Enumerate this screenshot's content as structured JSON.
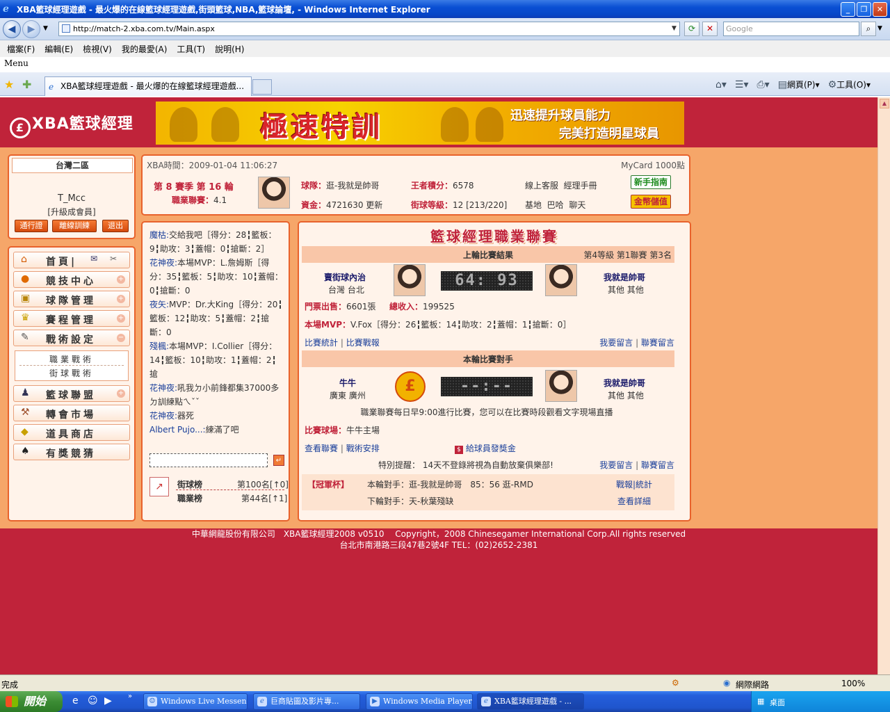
{
  "window": {
    "title": "XBA籃球經理遊戲 - 最火爆的在線籃球經理遊戲,街頭籃球,NBA,籃球論壇, - Windows Internet Explorer"
  },
  "address": {
    "url": "http://match-2.xba.com.tv/Main.aspx",
    "search_placeholder": "Google"
  },
  "menu": {
    "items": [
      "檔案(F)",
      "編輯(E)",
      "檢視(V)",
      "我的最愛(A)",
      "工具(T)",
      "說明(H)"
    ],
    "label": "Menu"
  },
  "tab": {
    "title": "XBA籃球經理遊戲 - 最火爆的在線籃球經理遊戲..."
  },
  "commands": {
    "page": "網頁(P)",
    "tools": "工具(O)"
  },
  "site": {
    "logo": "XBA籃球經理",
    "banner": {
      "title": "極速特訓",
      "sub1": "迅速提升球員能力",
      "sub2": "完美打造明星球員"
    }
  },
  "user": {
    "region": "台灣二區",
    "name": "T_Mcc",
    "upgrade": "[升級成會員]",
    "buttons": [
      "通行證",
      "離線訓練",
      "退出"
    ]
  },
  "nav": {
    "items": [
      {
        "label": "首頁|",
        "icon": "home-icon"
      },
      {
        "label": "競技中心",
        "icon": "basketball-icon"
      },
      {
        "label": "球隊管理",
        "icon": "team-icon"
      },
      {
        "label": "賽程管理",
        "icon": "trophy-icon"
      },
      {
        "label": "戰術設定",
        "icon": "tactics-icon"
      },
      {
        "label": "籃球聯盟",
        "icon": "league-icon"
      },
      {
        "label": "轉會市場",
        "icon": "hammer-icon"
      },
      {
        "label": "道具商店",
        "icon": "shop-icon"
      },
      {
        "label": "有獎競猜",
        "icon": "spade-icon"
      }
    ],
    "sub_items": [
      "職業戰術",
      "街球戰術"
    ]
  },
  "info": {
    "time_label": "XBA時間：",
    "time": "2009-01-04 11:06:27",
    "mycard": "MyCard 1000點",
    "season": "第 8 賽季 第 16 輪",
    "league_label": "職業聯賽：",
    "league_value": "4.1",
    "team_label": "球隊：",
    "team_value": "逛-我就是帥哥",
    "funds_label": "資金：",
    "funds_value": "4721630",
    "refresh": "更新",
    "king_label": "王者積分：",
    "king_value": "6578",
    "street_label": "街球等級：",
    "street_value": "12 [213/220]",
    "links1": [
      "線上客服",
      "經理手冊"
    ],
    "links2": [
      "基地",
      "巴哈",
      "聊天"
    ],
    "guide_btn": "新手指南",
    "gold_btn": "金幣儲值"
  },
  "news": {
    "lines": [
      {
        "name": "魔枯:",
        "text": "交給我吧［得分：28╏籃板：9╏助攻：3╏蓋帽：0╏搶斷：2］"
      },
      {
        "name": "花神夜:",
        "text": "本場MVP：L.詹姆斯［得分：35╏籃板：5╏助攻：10╏蓋帽：0╏搶斷：0"
      },
      {
        "name": "夜矢:",
        "text": "MVP：Dr.大King［得分：20╏籃板：12╏助攻：5╏蓋帽：2╏搶斷：0"
      },
      {
        "name": "殘楓:",
        "text": "本場MVP：I.Collier［得分：14╏籃板：10╏助攻：1╏蓋帽：2╏搶"
      },
      {
        "name": "花神夜:",
        "text": "吼我ㄉ小前鋒都集37000多ㄉ訓練點ㄟˇˇ"
      },
      {
        "name": "花神夜:",
        "text": "器死"
      },
      {
        "name": "Albert Pujo...:",
        "text": "練滿了吧"
      }
    ],
    "rank": [
      {
        "label": "街球榜",
        "value": "第100名[↑0]"
      },
      {
        "label": "職業榜",
        "value": "第44名[↑1]"
      }
    ]
  },
  "league": {
    "title": "籃球經理職業聯賽",
    "last": {
      "header": "上輪比賽結果",
      "level": "第4等級 第1聯賽 第3名",
      "home_team": "賣街球內治",
      "home_loc": "台灣 台北",
      "score": "64: 93",
      "away_team": "我就是帥哥",
      "away_loc": "其他 其他",
      "tickets_label": "門票出售：",
      "tickets_value": "6601張",
      "income_label": "總收入：",
      "income_value": "199525",
      "mvp_label": "本場MVP：",
      "mvp_value": "V.Fox［得分：26╏籃板：14╏助攻：2╏蓋帽：1╏搶斷：0］",
      "links_left": [
        "比賽統計",
        "比賽戰報"
      ],
      "links_right": [
        "我要留言",
        "聯賽留言"
      ]
    },
    "next": {
      "header": "本輪比賽對手",
      "home_team": "牛牛",
      "home_loc": "廣東 廣州",
      "score": "--:--",
      "away_team": "我就是帥哥",
      "away_loc": "其他 其他",
      "notice": "職業聯賽每日早9:00進行比賽，您可以在比賽時段觀看文字現場直播",
      "venue_label": "比賽球場：",
      "venue_value": "牛牛主場",
      "links_left": [
        "查看聯賽",
        "戰術安排"
      ],
      "bonus": "給球員發獎金",
      "warning": "特別提醒： 14天不登錄將視為自動放棄俱樂部!",
      "links_right": [
        "我要留言",
        "聯賽留言"
      ]
    },
    "cup": {
      "label": "【冠軍杯】",
      "current": "本輪對手：逛-我就是帥哥　85：56 逛-RMD",
      "next": "下輪對手：天-秋葉殘缺",
      "link1": "戰報|統計",
      "link2": "查看詳細"
    }
  },
  "footer": {
    "line1": "中華網龍股份有限公司　XBA籃球經理2008 v0510　 Copyright，2008 Chinesegamer International Corp.All rights reserved",
    "line2": "台北市南港路三段47巷2號4F TEL：(02)2652-2381"
  },
  "status": {
    "text": "完成",
    "zone": "網際網路",
    "zoom": "100%"
  },
  "taskbar": {
    "start": "開始",
    "tasks": [
      "Windows Live Messen...",
      "巨商貼圖及影片專...",
      "Windows Media Player",
      "XBA籃球經理遊戲 - ..."
    ],
    "tray": "桌面"
  }
}
